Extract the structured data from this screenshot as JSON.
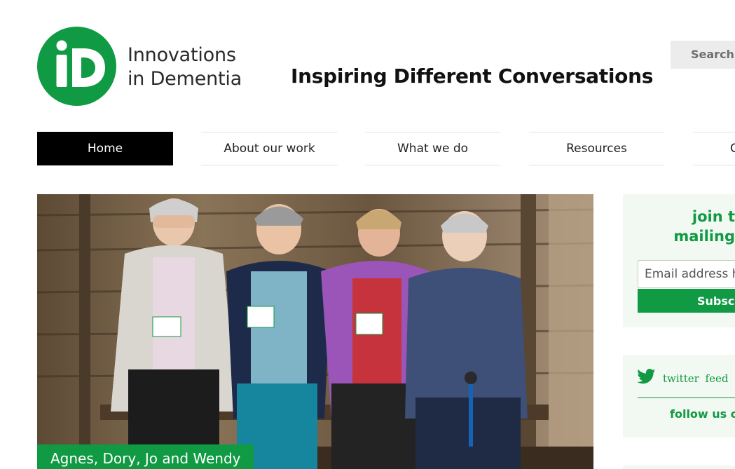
{
  "brand": {
    "logo_mark": "iD",
    "name_line1": "Innovations",
    "name_line2": "in Dementia",
    "color": "#109a43"
  },
  "header": {
    "tagline": "Inspiring Different Conversations",
    "search_label": "Search"
  },
  "nav": {
    "items": [
      {
        "label": "Home",
        "active": true
      },
      {
        "label": "About our work",
        "active": false
      },
      {
        "label": "What we do",
        "active": false
      },
      {
        "label": "Resources",
        "active": false
      },
      {
        "label": "C",
        "active": false
      }
    ]
  },
  "hero": {
    "caption": "Agnes, Dory, Jo and Wendy"
  },
  "sidebar": {
    "join": {
      "title_line1": "join t",
      "title_line2": "mailing",
      "email_placeholder": "Email address he",
      "subscribe_label": "Subscr"
    },
    "twitter": {
      "icon": "twitter-bird-icon",
      "label": "twitter feed",
      "follow_label": "follow us or"
    }
  }
}
